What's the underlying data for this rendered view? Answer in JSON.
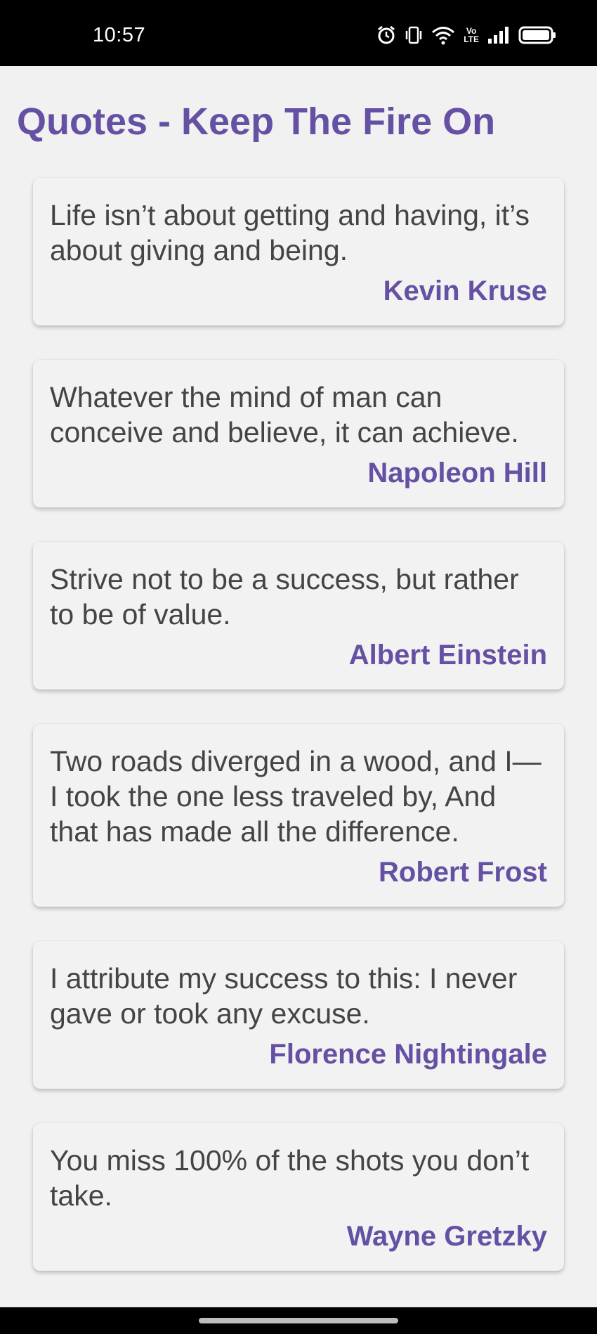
{
  "status_bar": {
    "time": "10:57",
    "icons": [
      "alarm-icon",
      "vibrate-icon",
      "wifi-icon",
      "volte-icon",
      "cell-signal-icon",
      "battery-icon"
    ],
    "volte_line1": "Vo",
    "volte_line2": "LTE"
  },
  "page": {
    "title": "Quotes - Keep The Fire On"
  },
  "quotes": [
    {
      "text": "Life isn’t about getting and having, it’s about giving and being.",
      "author": "Kevin Kruse"
    },
    {
      "text": "Whatever the mind of man can conceive and believe, it can achieve.",
      "author": "Napoleon Hill"
    },
    {
      "text": "Strive not to be a success, but rather to be of value.",
      "author": "Albert Einstein"
    },
    {
      "text": "Two roads diverged in a wood, and I—I took the one less traveled by, And that has made all the difference.",
      "author": "Robert Frost"
    },
    {
      "text": "I attribute my success to this: I never gave or took any excuse.",
      "author": "Florence Nightingale"
    },
    {
      "text": "You miss 100% of the shots you don’t take.",
      "author": "Wayne Gretzky"
    }
  ],
  "colors": {
    "accent": "#6550a4",
    "quote_text": "#444444",
    "background": "#f1f1f1",
    "status_bar": "#000000"
  }
}
